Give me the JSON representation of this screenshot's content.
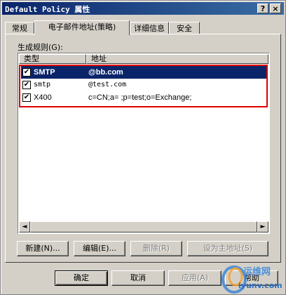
{
  "window": {
    "title": "Default Policy 属性",
    "help_btn": "?",
    "close_btn": "×"
  },
  "tabs": [
    {
      "label": "常规"
    },
    {
      "label": "电子邮件地址(策略)"
    },
    {
      "label": "详细信息"
    },
    {
      "label": "安全"
    }
  ],
  "rules": {
    "label": "生成规则(G):",
    "columns": {
      "type": "类型",
      "address": "地址"
    },
    "rows": [
      {
        "checked": true,
        "check_glyph": "✔",
        "type": "SMTP",
        "address": "@bb.com",
        "selected": true
      },
      {
        "checked": true,
        "check_glyph": "✔",
        "type": "smtp",
        "address": "@test.com",
        "selected": false
      },
      {
        "checked": true,
        "check_glyph": "✔",
        "type": "X400",
        "address": "c=CN;a= ;p=test;o=Exchange;",
        "selected": false
      }
    ],
    "scroll_left": "◄",
    "scroll_right": "►"
  },
  "list_buttons": {
    "new": "新建(N)...",
    "edit": "编辑(E)...",
    "remove": "删除(R)",
    "set_primary": "设为主地址(S)"
  },
  "dialog_buttons": {
    "ok": "确定",
    "cancel": "取消",
    "apply": "应用(A)",
    "help": "帮助"
  },
  "watermark": {
    "line1": "运维网",
    "line2": "iyunv.com"
  },
  "colors": {
    "title_bar": "#0a246a",
    "selection": "#0a246a",
    "highlight_box": "#e00000",
    "dialog_bg": "#d4d0c8"
  }
}
